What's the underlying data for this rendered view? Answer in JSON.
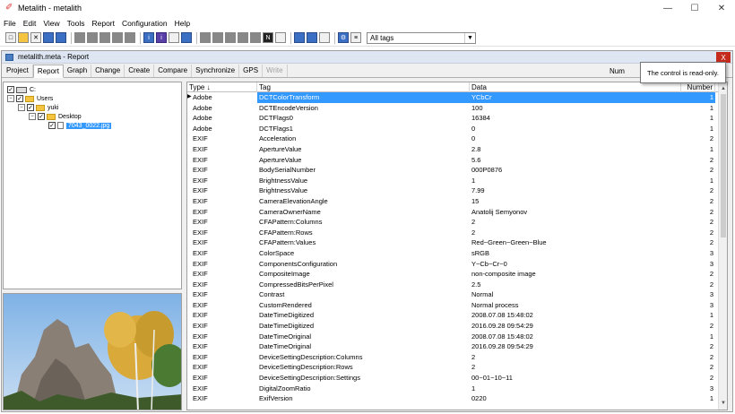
{
  "window": {
    "title": "Metalith - metalith"
  },
  "menu": [
    "File",
    "Edit",
    "View",
    "Tools",
    "Report",
    "Configuration",
    "Help"
  ],
  "toolbar": {
    "tags_select": "All tags"
  },
  "child": {
    "title": "metalith.meta - Report",
    "close": "X",
    "tabs": [
      "Project",
      "Report",
      "Graph",
      "Change",
      "Create",
      "Compare",
      "Synchronize",
      "GPS",
      "Write"
    ],
    "active_tab": "Report"
  },
  "tooltip": "The control is read-only.",
  "partial_header": "Num",
  "tree": {
    "root": "C:",
    "users": "Users",
    "yuki": "yuki",
    "desktop": "Desktop",
    "file": "7043_0022.jpg"
  },
  "table": {
    "headers": {
      "type": "Type ↓",
      "tag": "Tag",
      "data": "Data",
      "num": "Number"
    },
    "rows": [
      {
        "type": "Adobe",
        "tag": "DCTColorTransform",
        "data": "YCbCr",
        "num": "1"
      },
      {
        "type": "Adobe",
        "tag": "DCTEncodeVersion",
        "data": "100",
        "num": "1"
      },
      {
        "type": "Adobe",
        "tag": "DCTFlags0",
        "data": "16384",
        "num": "1"
      },
      {
        "type": "Adobe",
        "tag": "DCTFlags1",
        "data": "0",
        "num": "1"
      },
      {
        "type": "EXIF",
        "tag": "Acceleration",
        "data": "0",
        "num": "2"
      },
      {
        "type": "EXIF",
        "tag": "ApertureValue",
        "data": "2.8",
        "num": "1"
      },
      {
        "type": "EXIF",
        "tag": "ApertureValue",
        "data": "5.6",
        "num": "2"
      },
      {
        "type": "EXIF",
        "tag": "BodySerialNumber",
        "data": "000P0876",
        "num": "2"
      },
      {
        "type": "EXIF",
        "tag": "BrightnessValue",
        "data": "1",
        "num": "1"
      },
      {
        "type": "EXIF",
        "tag": "BrightnessValue",
        "data": "7.99",
        "num": "2"
      },
      {
        "type": "EXIF",
        "tag": "CameraElevationAngle",
        "data": "15",
        "num": "2"
      },
      {
        "type": "EXIF",
        "tag": "CameraOwnerName",
        "data": "Anatolij Semyonov",
        "num": "2"
      },
      {
        "type": "EXIF",
        "tag": "CFAPattern:Columns",
        "data": "2",
        "num": "2"
      },
      {
        "type": "EXIF",
        "tag": "CFAPattern:Rows",
        "data": "2",
        "num": "2"
      },
      {
        "type": "EXIF",
        "tag": "CFAPattern:Values",
        "data": "Red~Green~Green~Blue",
        "num": "2"
      },
      {
        "type": "EXIF",
        "tag": "ColorSpace",
        "data": "sRGB",
        "num": "3"
      },
      {
        "type": "EXIF",
        "tag": "ComponentsConfiguration",
        "data": "Y~Cb~Cr~0",
        "num": "3"
      },
      {
        "type": "EXIF",
        "tag": "CompositeImage",
        "data": "non-composite image",
        "num": "2"
      },
      {
        "type": "EXIF",
        "tag": "CompressedBitsPerPixel",
        "data": "2.5",
        "num": "2"
      },
      {
        "type": "EXIF",
        "tag": "Contrast",
        "data": "Normal",
        "num": "3"
      },
      {
        "type": "EXIF",
        "tag": "CustomRendered",
        "data": "Normal process",
        "num": "3"
      },
      {
        "type": "EXIF",
        "tag": "DateTimeDigitized",
        "data": "2008.07.08 15:48:02",
        "num": "1"
      },
      {
        "type": "EXIF",
        "tag": "DateTimeDigitized",
        "data": "2016.09.28 09:54:29",
        "num": "2"
      },
      {
        "type": "EXIF",
        "tag": "DateTimeOriginal",
        "data": "2008.07.08 15:48:02",
        "num": "1"
      },
      {
        "type": "EXIF",
        "tag": "DateTimeOriginal",
        "data": "2016.09.28 09:54:29",
        "num": "2"
      },
      {
        "type": "EXIF",
        "tag": "DeviceSettingDescription:Columns",
        "data": "2",
        "num": "2"
      },
      {
        "type": "EXIF",
        "tag": "DeviceSettingDescription:Rows",
        "data": "2",
        "num": "2"
      },
      {
        "type": "EXIF",
        "tag": "DeviceSettingDescription:Settings",
        "data": "00~01~10~11",
        "num": "2"
      },
      {
        "type": "EXIF",
        "tag": "DigitalZoomRatio",
        "data": "1",
        "num": "3"
      },
      {
        "type": "EXIF",
        "tag": "ExifVersion",
        "data": "0220",
        "num": "1"
      }
    ]
  }
}
